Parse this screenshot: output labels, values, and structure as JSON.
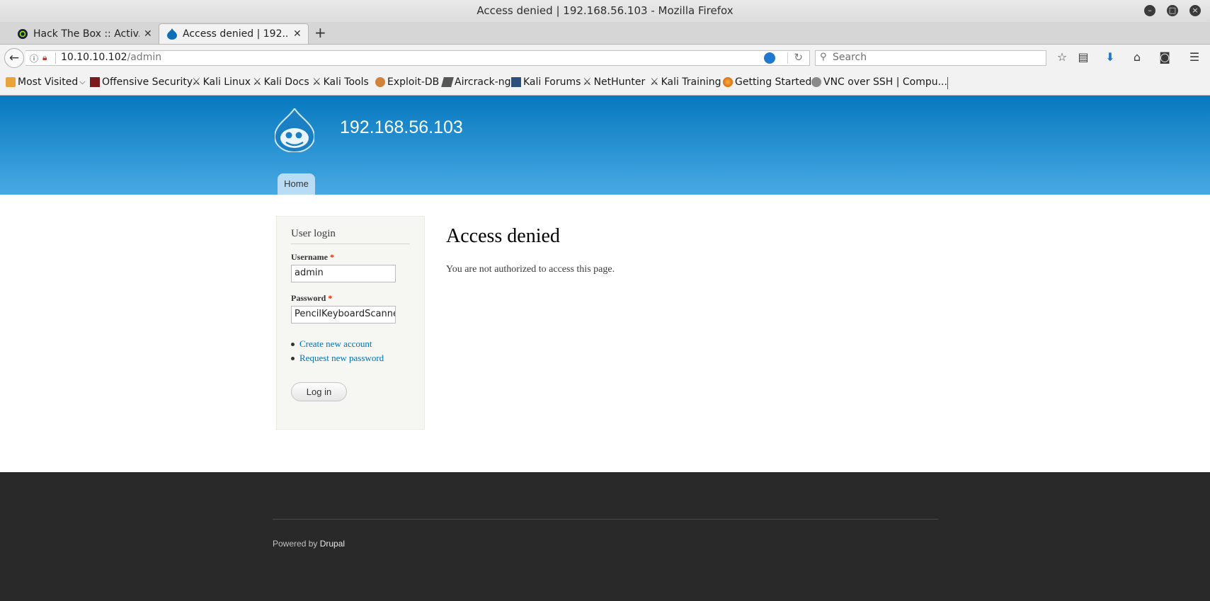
{
  "window": {
    "title": "Access denied | 192.168.56.103 - Mozilla Firefox"
  },
  "tabs": [
    {
      "label": "Hack The Box :: Activ...",
      "active": false
    },
    {
      "label": "Access denied | 192....",
      "active": true
    }
  ],
  "navbar": {
    "url_host": "10.10.10.102",
    "url_path": "/admin",
    "search_placeholder": "Search"
  },
  "bookmarks": [
    {
      "label": "Most Visited",
      "icon": "folder-icon"
    },
    {
      "label": "Offensive Security",
      "icon": "offsec-icon"
    },
    {
      "label": "Kali Linux",
      "icon": "kali-dragon-icon"
    },
    {
      "label": "Kali Docs",
      "icon": "kali-dragon-icon"
    },
    {
      "label": "Kali Tools",
      "icon": "kali-dragon-icon"
    },
    {
      "label": "Exploit-DB",
      "icon": "exploitdb-icon"
    },
    {
      "label": "Aircrack-ng",
      "icon": "aircrack-icon"
    },
    {
      "label": "Kali Forums",
      "icon": "kali-forums-icon"
    },
    {
      "label": "NetHunter",
      "icon": "kali-dragon-icon"
    },
    {
      "label": "Kali Training",
      "icon": "kali-dragon-icon"
    },
    {
      "label": "Getting Started",
      "icon": "firefox-icon"
    },
    {
      "label": "VNC over SSH | Compu...",
      "icon": "globe-icon"
    }
  ],
  "site": {
    "name": "192.168.56.103",
    "nav_home": "Home"
  },
  "login": {
    "title": "User login",
    "username_label": "Username",
    "username_value": "admin",
    "password_label": "Password",
    "password_value": "PencilKeyboardScanner",
    "required_marker": "*",
    "create_account": "Create new account",
    "request_password": "Request new password",
    "submit": "Log in"
  },
  "main": {
    "title": "Access denied",
    "message": "You are not authorized to access this page."
  },
  "footer": {
    "powered_by": "Powered by",
    "drupal": "Drupal"
  },
  "colors": {
    "header_top": "#0779bf",
    "header_bottom": "#48a9e4",
    "link": "#0071b3",
    "footer_bg": "#292929",
    "required": "#e32700"
  }
}
